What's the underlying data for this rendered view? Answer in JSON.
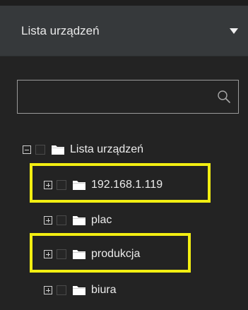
{
  "header": {
    "title": "Lista urządzeń",
    "caret_icon": "caret-down-icon"
  },
  "search": {
    "value": "",
    "placeholder": ""
  },
  "tree": {
    "root": {
      "label": "Lista urządzeń",
      "expanded": true
    },
    "children": [
      {
        "label": "192.168.1.119",
        "expanded": false,
        "highlighted": true
      },
      {
        "label": "plac",
        "expanded": false,
        "highlighted": false
      },
      {
        "label": "produkcja",
        "expanded": false,
        "highlighted": true
      },
      {
        "label": "biura",
        "expanded": false,
        "highlighted": false
      }
    ]
  },
  "colors": {
    "highlight": "#f2ee12",
    "header_bg": "#36393b",
    "panel_bg": "#232323"
  }
}
